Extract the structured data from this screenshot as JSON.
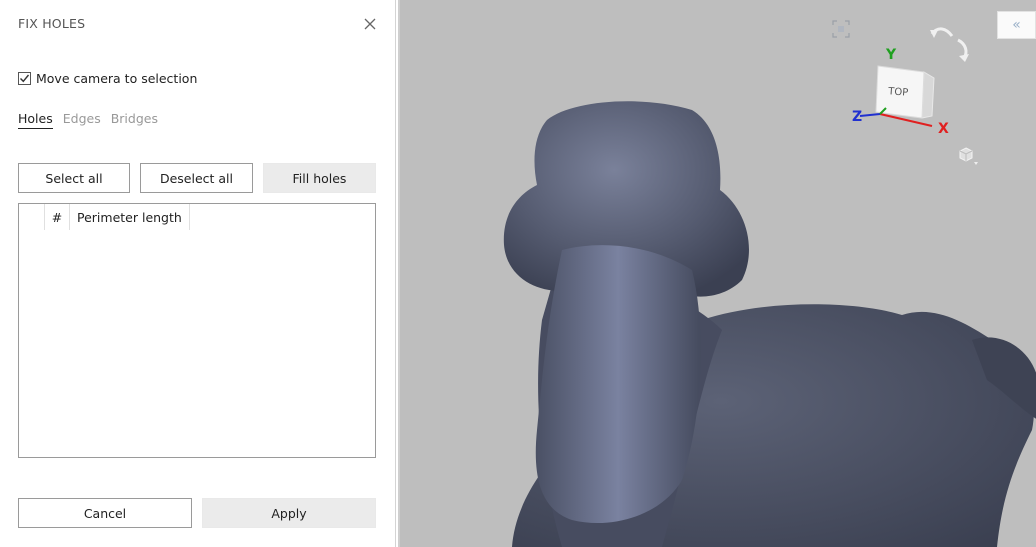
{
  "panel": {
    "title": "FIX HOLES",
    "move_camera_label": "Move camera to selection",
    "move_camera_checked": true,
    "tabs": [
      {
        "label": "Holes",
        "active": true
      },
      {
        "label": "Edges",
        "active": false
      },
      {
        "label": "Bridges",
        "active": false
      }
    ],
    "buttons": {
      "select_all": "Select all",
      "deselect_all": "Deselect all",
      "fill_holes": "Fill holes",
      "cancel": "Cancel",
      "apply": "Apply"
    },
    "table": {
      "columns": [
        "",
        "#",
        "Perimeter length"
      ],
      "rows": []
    }
  },
  "viewport": {
    "background": "#bebebe",
    "model_color": "#4a5063",
    "view_cube": {
      "face_label": "TOP",
      "axes": [
        {
          "label": "X",
          "color": "#e02020"
        },
        {
          "label": "Y",
          "color": "#20a020"
        },
        {
          "label": "Z",
          "color": "#2030d0"
        }
      ]
    },
    "icons": [
      "fit-view-icon",
      "rotate-left-icon",
      "rotate-right-icon",
      "view-mode-icon"
    ],
    "collapse_label": "«"
  }
}
